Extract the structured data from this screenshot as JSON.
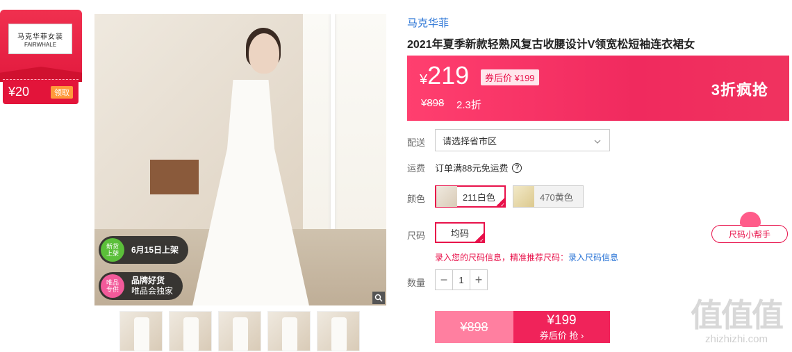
{
  "brand_card": {
    "logo_cn": "马克华菲女装",
    "logo_en": "FAIRWHALE",
    "coupon_amount": "¥20",
    "claim_label": "领取"
  },
  "badges": {
    "new": {
      "bubble": "新货上架",
      "text": "6月15日上架"
    },
    "brand": {
      "bubble": "唯品专供",
      "line1": "品牌好货",
      "line2": "唯品会独家"
    }
  },
  "product": {
    "brand": "马克华菲",
    "title": "2021年夏季新款轻熟风复古收腰设计V领宽松短袖连衣裙女"
  },
  "price": {
    "current": "219",
    "currency": "¥",
    "coupon_price": "券后价 ¥199",
    "original": "¥898",
    "discount": "2.3折",
    "flash_deal": "3折疯抢"
  },
  "delivery": {
    "label": "配送",
    "placeholder": "请选择省市区"
  },
  "shipping": {
    "label": "运费",
    "text": "订单满88元免运费"
  },
  "color": {
    "label": "颜色",
    "options": [
      "211白色",
      "470黄色"
    ],
    "selected": "211白色"
  },
  "size": {
    "label": "尺码",
    "options": [
      "均码"
    ],
    "helper": "尺码小帮手",
    "hint": "录入您的尺码信息，精准推荐尺码：",
    "hint_link": "录入尺码信息"
  },
  "quantity": {
    "label": "数量",
    "value": "1"
  },
  "buy": {
    "original": "¥898",
    "price": "¥199",
    "action": "券后价 抢 ›"
  },
  "watermark": {
    "big": "值值值",
    "small": "zhizhizhi.com"
  },
  "colors": {
    "accent": "#f0235a",
    "link": "#2a74d6"
  }
}
